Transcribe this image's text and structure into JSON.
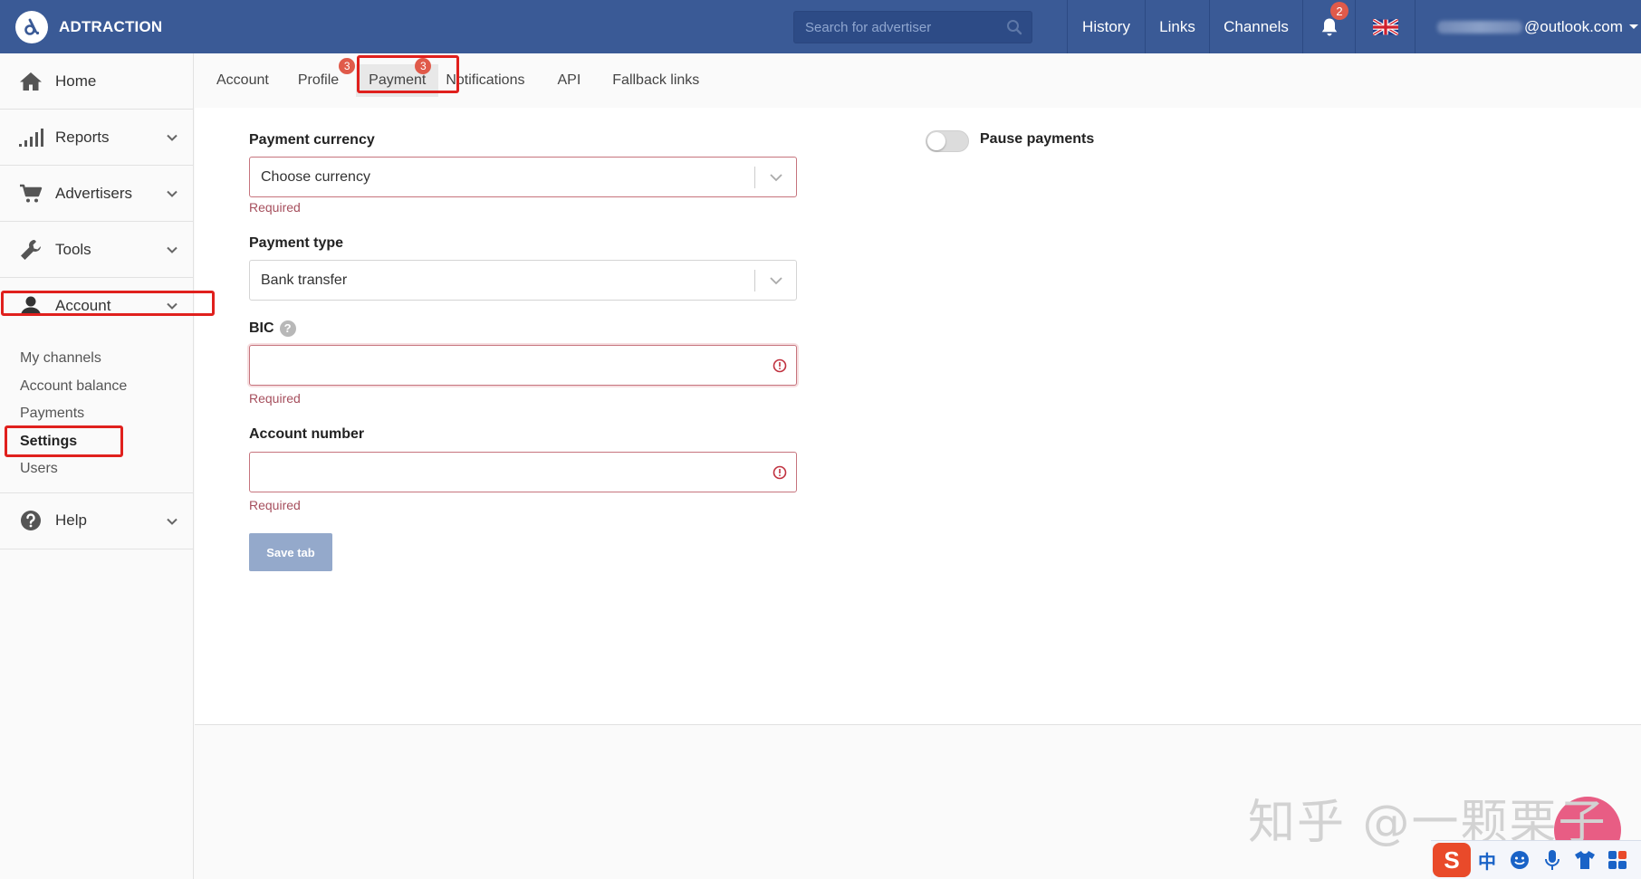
{
  "header": {
    "brand": "ADTRACTION",
    "search_placeholder": "Search for advertiser",
    "nav": [
      "History",
      "Links",
      "Channels"
    ],
    "notification_count": "2",
    "user_email": "@outlook.com"
  },
  "sidebar": {
    "items": [
      {
        "label": "Home",
        "icon": "home-icon"
      },
      {
        "label": "Reports",
        "icon": "bar-chart-icon"
      },
      {
        "label": "Advertisers",
        "icon": "cart-icon"
      },
      {
        "label": "Tools",
        "icon": "wrench-icon"
      },
      {
        "label": "Account",
        "icon": "user-icon"
      },
      {
        "label": "Help",
        "icon": "question-icon"
      }
    ],
    "account_sub": [
      "My channels",
      "Account balance",
      "Payments",
      "Settings",
      "Users"
    ]
  },
  "tabs": {
    "items": [
      "Account",
      "Profile",
      "Payment",
      "Notifications",
      "API",
      "Fallback links"
    ],
    "profile_badge": "3",
    "payment_badge": "3"
  },
  "form": {
    "currency_label": "Payment currency",
    "currency_value": "Choose currency",
    "type_label": "Payment type",
    "type_value": "Bank transfer",
    "bic_label": "BIC",
    "bic_value": "",
    "account_label": "Account number",
    "account_value": "",
    "required_text": "Required",
    "save_label": "Save tab",
    "pause_label": "Pause payments",
    "pause_on": false
  },
  "watermark": "知乎 @一颗栗子",
  "ime": {
    "mode": "中"
  }
}
